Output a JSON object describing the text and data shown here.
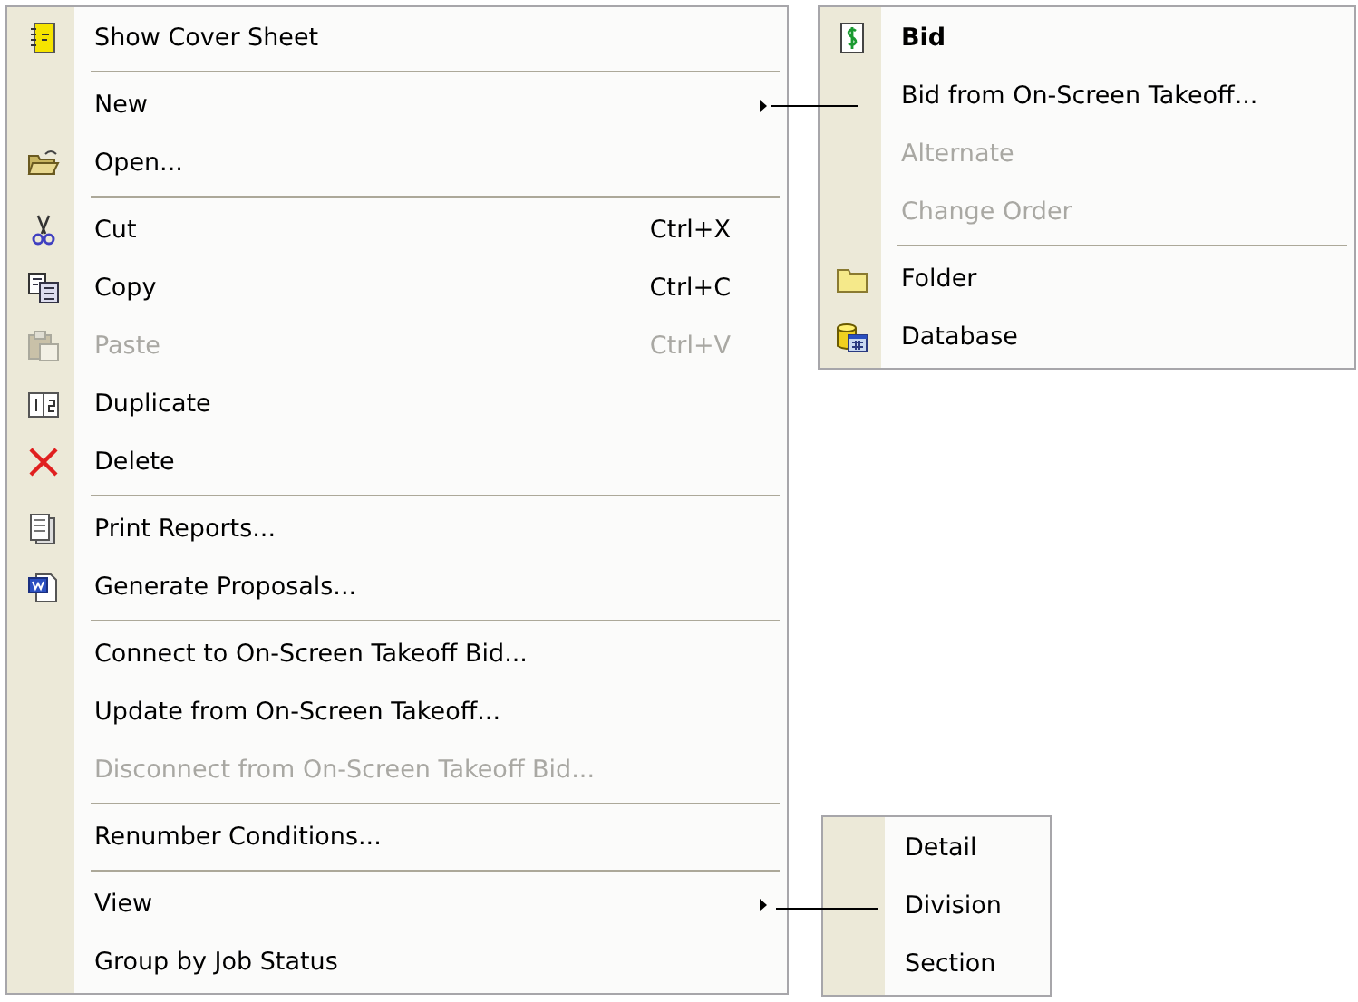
{
  "menu": {
    "items": [
      {
        "kind": "item",
        "label": "Show Cover Sheet",
        "disabled": false
      },
      {
        "kind": "separator"
      },
      {
        "kind": "item",
        "label": "New",
        "disabled": false,
        "submenu": true
      },
      {
        "kind": "item",
        "label": "Open...",
        "disabled": false
      },
      {
        "kind": "separator"
      },
      {
        "kind": "item",
        "label": "Cut",
        "shortcut": "Ctrl+X",
        "disabled": false
      },
      {
        "kind": "item",
        "label": "Copy",
        "shortcut": "Ctrl+C",
        "disabled": false
      },
      {
        "kind": "item",
        "label": "Paste",
        "shortcut": "Ctrl+V",
        "disabled": true
      },
      {
        "kind": "item",
        "label": "Duplicate",
        "disabled": false
      },
      {
        "kind": "item",
        "label": "Delete",
        "disabled": false
      },
      {
        "kind": "separator"
      },
      {
        "kind": "item",
        "label": "Print Reports...",
        "disabled": false
      },
      {
        "kind": "item",
        "label": "Generate Proposals...",
        "disabled": false
      },
      {
        "kind": "separator"
      },
      {
        "kind": "item",
        "label": "Connect to On-Screen Takeoff Bid...",
        "disabled": false
      },
      {
        "kind": "item",
        "label": "Update from On-Screen Takeoff...",
        "disabled": false
      },
      {
        "kind": "item",
        "label": "Disconnect from On-Screen Takeoff Bid...",
        "disabled": true
      },
      {
        "kind": "separator"
      },
      {
        "kind": "item",
        "label": "Renumber Conditions...",
        "disabled": false
      },
      {
        "kind": "separator"
      },
      {
        "kind": "item",
        "label": "View",
        "disabled": false,
        "submenu": true
      },
      {
        "kind": "item",
        "label": "Group by Job Status",
        "disabled": false
      }
    ]
  },
  "submenus": [
    {
      "items": [
        {
          "kind": "item",
          "label": "Bid",
          "disabled": false,
          "default": true
        },
        {
          "kind": "item",
          "label": "Bid from On-Screen Takeoff...",
          "disabled": false
        },
        {
          "kind": "item",
          "label": "Alternate",
          "disabled": true
        },
        {
          "kind": "item",
          "label": "Change Order",
          "disabled": true
        },
        {
          "kind": "separator"
        },
        {
          "kind": "item",
          "label": "Folder",
          "disabled": false
        },
        {
          "kind": "item",
          "label": "Database",
          "disabled": false
        }
      ]
    },
    {
      "items": [
        {
          "kind": "item",
          "label": "Detail",
          "disabled": false
        },
        {
          "kind": "item",
          "label": "Division",
          "disabled": false
        },
        {
          "kind": "item",
          "label": "Section",
          "disabled": false
        }
      ]
    }
  ]
}
